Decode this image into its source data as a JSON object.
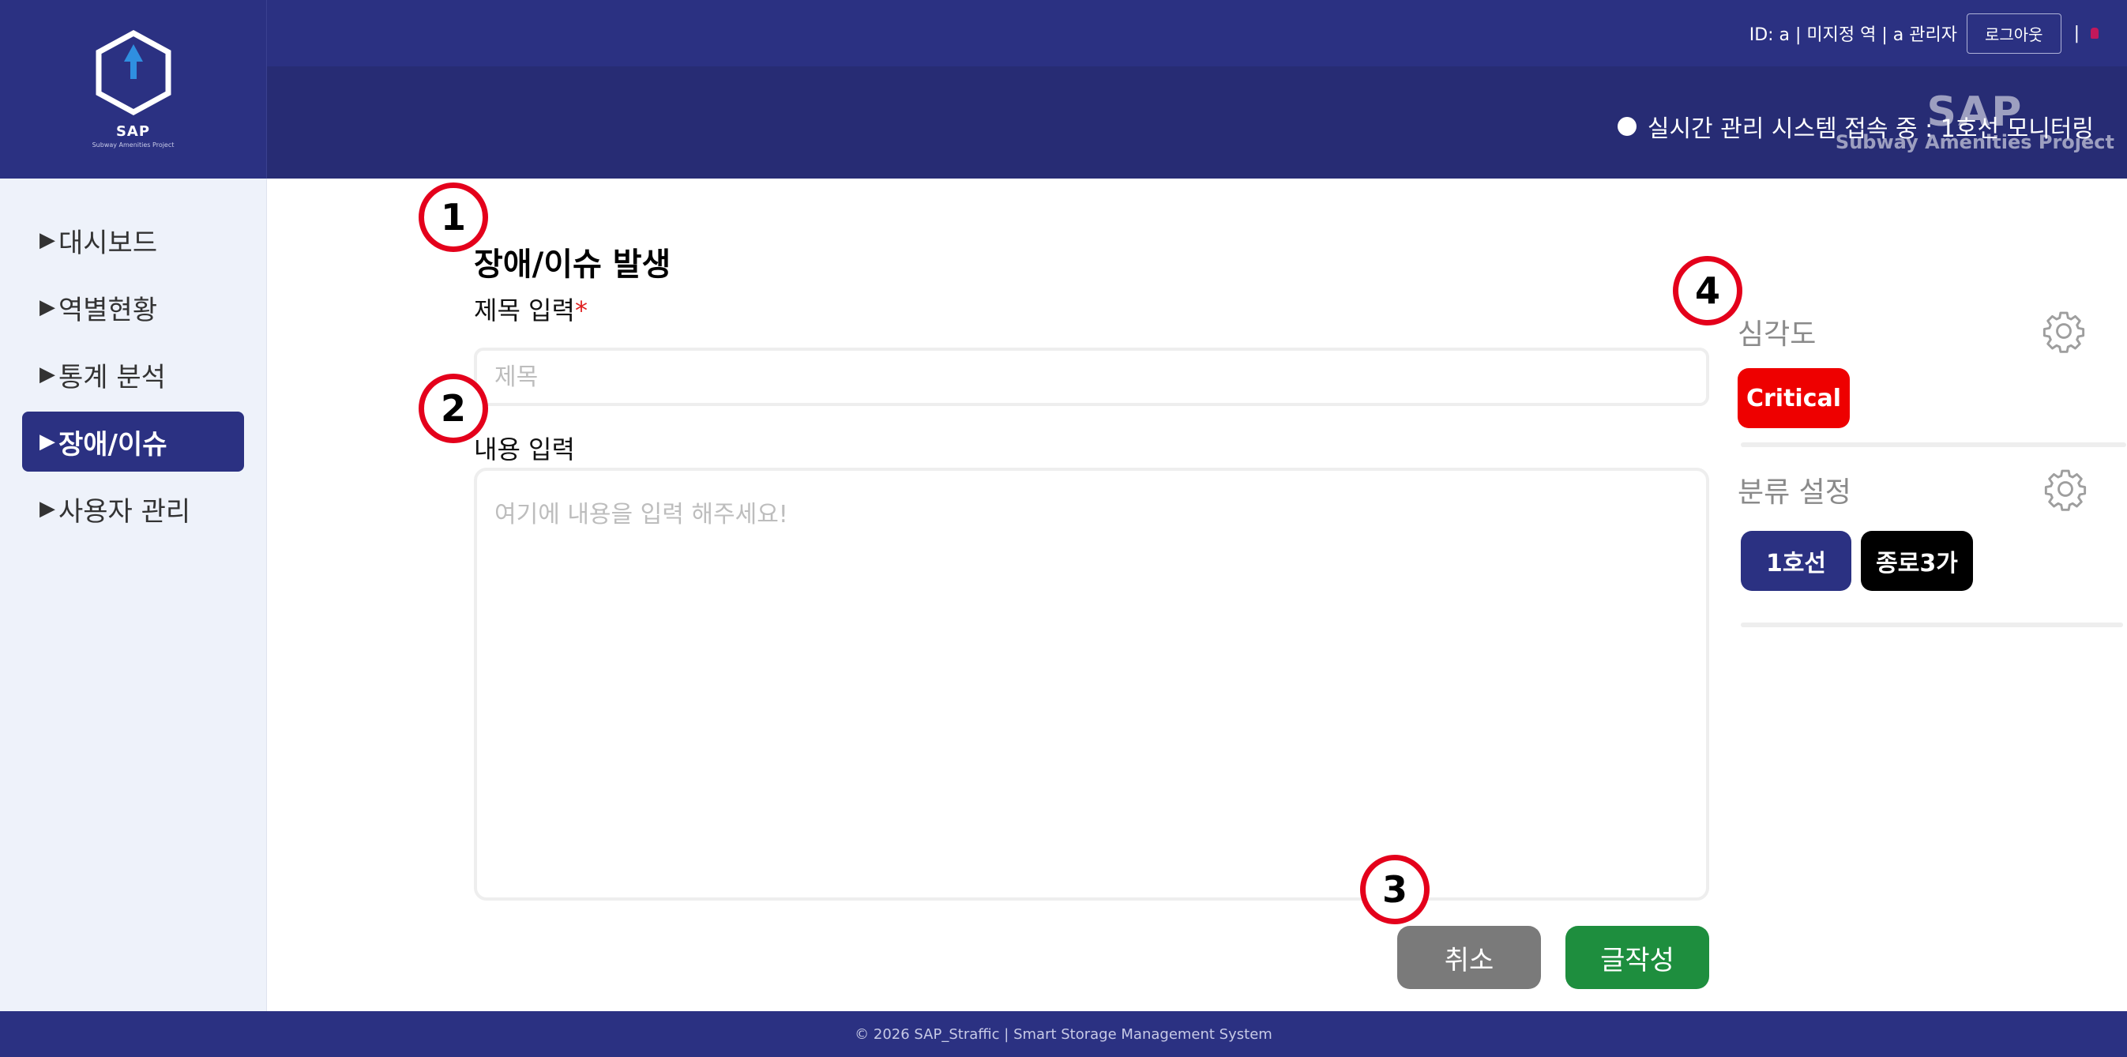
{
  "brand": {
    "logo_letters": "SAP",
    "name": "SAP",
    "subtitle": "Subway Amenities Project"
  },
  "topbar": {
    "user_info": "ID: a | 미지정 역 | a 관리자",
    "logout_label": "로그아웃",
    "separator": "|"
  },
  "subbar": {
    "status_text": "실시간 관리 시스템 접속 중 : 1호선 모니터링",
    "watermark_big": "SAP",
    "watermark_small": "Subway Amenities Project"
  },
  "sidebar": {
    "arrow": "▶",
    "items": [
      {
        "label": "대시보드"
      },
      {
        "label": "역별현황"
      },
      {
        "label": "통계 분석"
      },
      {
        "label": "장애/이슈"
      },
      {
        "label": "사용자 관리"
      }
    ]
  },
  "form": {
    "title": "장애/이슈 발생",
    "title_label": "제목 입력",
    "required_mark": "*",
    "title_placeholder": "제목",
    "content_label": "내용 입력",
    "content_placeholder": "여기에 내용을 입력 해주세요!",
    "cancel_label": "취소",
    "submit_label": "글작성"
  },
  "panel": {
    "severity_label": "심각도",
    "severity_value": "Critical",
    "category_label": "분류 설정",
    "category_tags": [
      "1호선",
      "종로3가"
    ]
  },
  "markers": [
    "1",
    "2",
    "3",
    "4"
  ],
  "footer": {
    "text": "© 2026 SAP_Straffic | Smart Storage Management System"
  },
  "colors": {
    "primary": "#2b3182",
    "critical": "#ee0000",
    "submit": "#1e8e3e",
    "cancel": "#7a7a7a",
    "marker": "#e4001b"
  }
}
